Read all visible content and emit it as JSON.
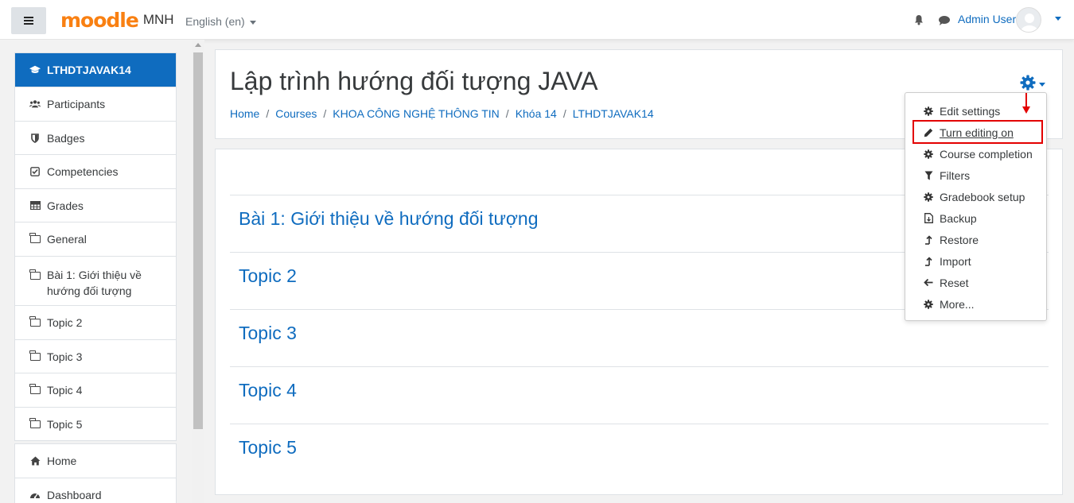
{
  "navbar": {
    "logo_text": "moodle",
    "site_name": "MNH",
    "language": "English (en)",
    "user_name": "Admin User",
    "icons": [
      "menu-icon",
      "bell-icon",
      "chat-icon",
      "user-avatar-icon"
    ]
  },
  "drawer": {
    "course_items": [
      {
        "label": "LTHDTJAVAK14",
        "icon": "graduation-cap-icon",
        "active": true
      },
      {
        "label": "Participants",
        "icon": "users-icon"
      },
      {
        "label": "Badges",
        "icon": "shield-icon"
      },
      {
        "label": "Competencies",
        "icon": "check-square-icon"
      },
      {
        "label": "Grades",
        "icon": "table-icon"
      },
      {
        "label": "General",
        "icon": "folder-icon"
      },
      {
        "label": "Bài 1: Giới thiệu về hướng đối tượng",
        "label_line1": "Bài 1: Giới thiệu về",
        "label_line2": "hướng đối tượng",
        "icon": "folder-icon"
      },
      {
        "label": "Topic 2",
        "icon": "folder-icon"
      },
      {
        "label": "Topic 3",
        "icon": "folder-icon"
      },
      {
        "label": "Topic 4",
        "icon": "folder-icon"
      },
      {
        "label": "Topic 5",
        "icon": "folder-icon"
      }
    ],
    "site_items": [
      {
        "label": "Home",
        "icon": "home-icon"
      },
      {
        "label": "Dashboard",
        "icon": "dashboard-icon"
      }
    ]
  },
  "header": {
    "title": "Lập trình hướng đối tượng JAVA",
    "breadcrumb": [
      "Home",
      "Courses",
      "KHOA CÔNG NGHỆ THÔNG TIN",
      "Khóa 14",
      "LTHDTJAVAK14"
    ],
    "breadcrumb_separator": "/"
  },
  "sections": [
    {
      "title": "Bài 1: Giới thiệu về hướng đối tượng"
    },
    {
      "title": "Topic 2"
    },
    {
      "title": "Topic 3"
    },
    {
      "title": "Topic 4"
    },
    {
      "title": "Topic 5"
    }
  ],
  "course_menu": {
    "items": [
      {
        "label": "Edit settings",
        "icon": "gear-icon"
      },
      {
        "label": "Turn editing on",
        "icon": "pencil-icon",
        "highlighted": true
      },
      {
        "label": "Course completion",
        "icon": "gear-icon"
      },
      {
        "label": "Filters",
        "icon": "filter-icon"
      },
      {
        "label": "Gradebook setup",
        "icon": "gear-icon"
      },
      {
        "label": "Backup",
        "icon": "file-icon"
      },
      {
        "label": "Restore",
        "icon": "upload-icon"
      },
      {
        "label": "Import",
        "icon": "upload-icon"
      },
      {
        "label": "Reset",
        "icon": "arrow-left-icon"
      },
      {
        "label": "More...",
        "icon": "gear-icon"
      }
    ]
  },
  "colors": {
    "accent": "#0f6cbf",
    "annotation": "#e30000",
    "brand_orange": "#f98012"
  }
}
